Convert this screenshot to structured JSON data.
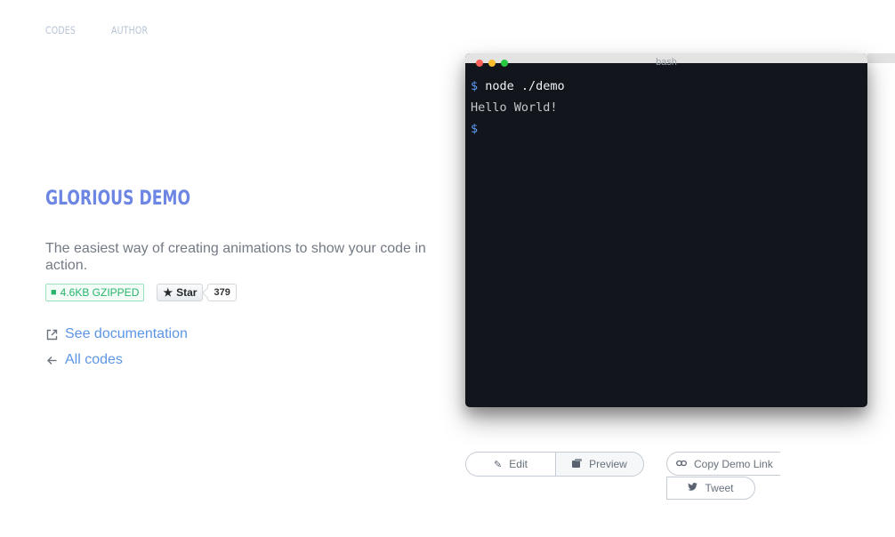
{
  "nav": {
    "codes": "CODES",
    "author": "AUTHOR"
  },
  "hero": {
    "title": "GLORIOUS DEMO",
    "description": "The easiest way of creating animations to show your code in action."
  },
  "badges": {
    "size": "4.6KB GZIPPED",
    "star_label": "Star",
    "star_count": "379"
  },
  "links": {
    "docs": "See documentation",
    "all_codes": "All codes"
  },
  "terminal": {
    "title": "bash",
    "prompt": "$",
    "command": "node ./demo",
    "output": "Hello World!"
  },
  "actions": {
    "edit": "Edit",
    "preview": "Preview",
    "copy_link": "Copy Demo Link",
    "tweet": "Tweet"
  },
  "colors": {
    "accent": "#6e86e3",
    "link": "#5d95e6",
    "badge_green": "#28b46c",
    "terminal_bg": "#12161c"
  }
}
